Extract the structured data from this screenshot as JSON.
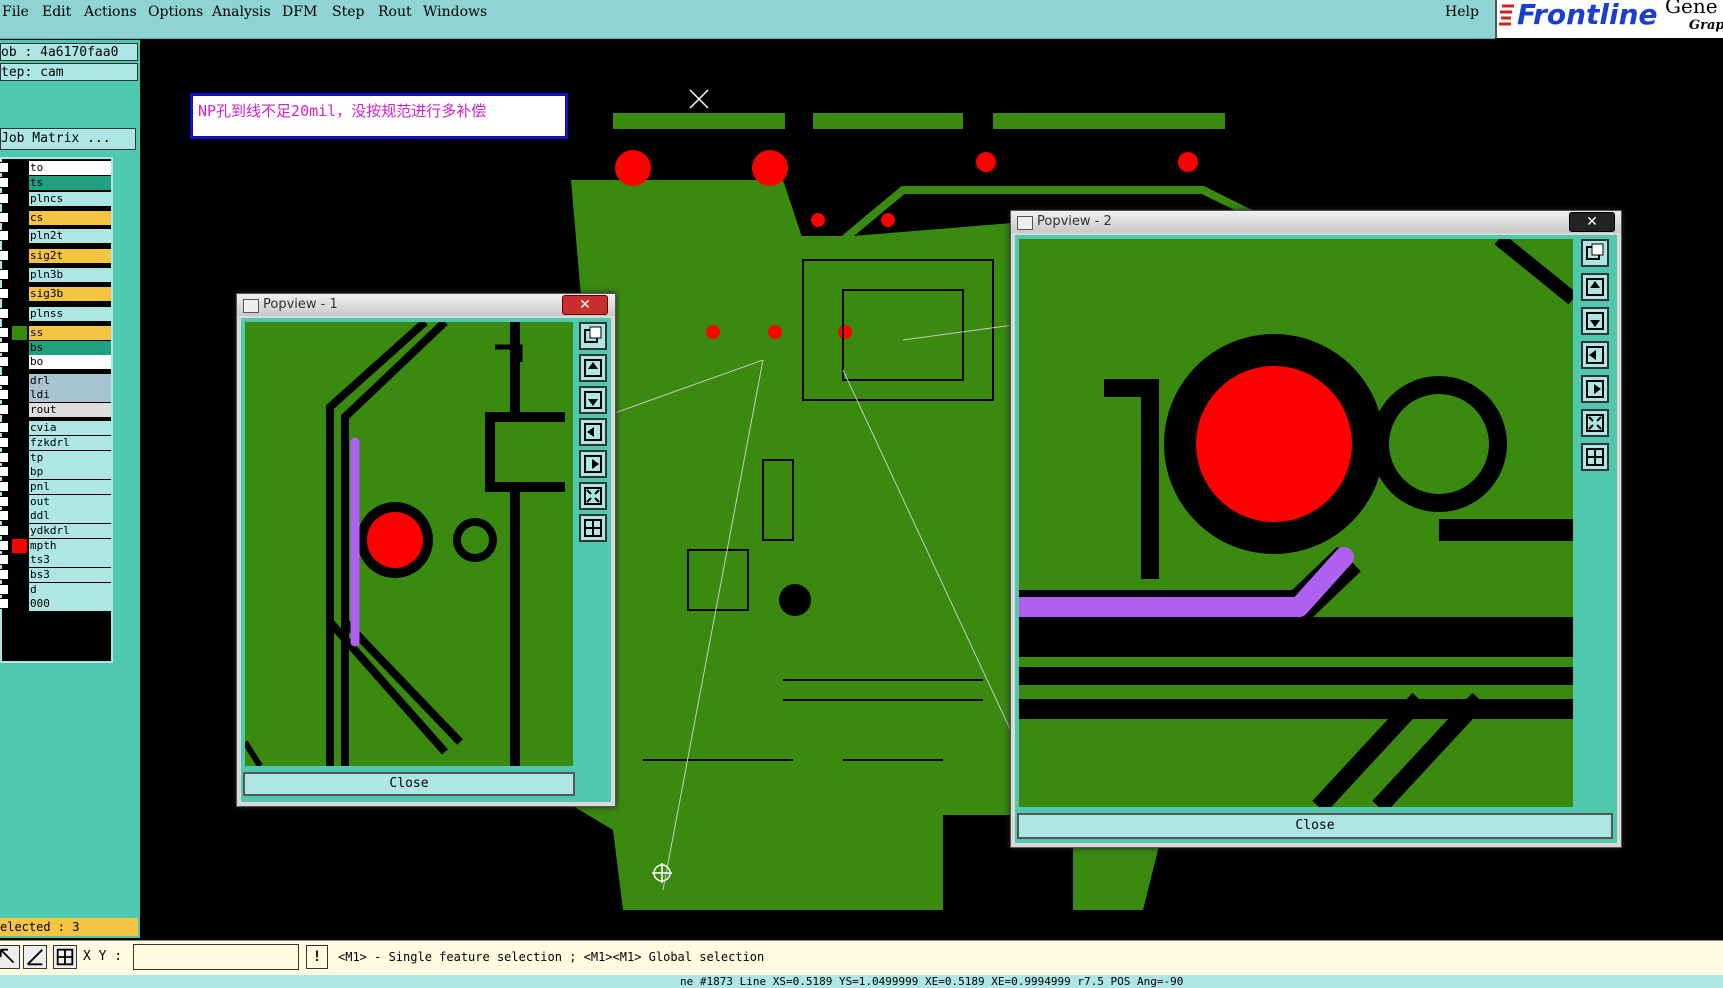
{
  "menu": {
    "items": [
      "File",
      "Edit",
      "Actions",
      "Options",
      "Analysis",
      "DFM",
      "Step",
      "Rout",
      "Windows"
    ],
    "help": "Help"
  },
  "logo": {
    "brand": "Frontline",
    "tail": "Gene",
    "sub": "Graph"
  },
  "left_panel": {
    "job": "ob  : 4a6170faa0",
    "step": "tep: cam",
    "job_matrix": "Job Matrix ...",
    "selected": "elected : 3"
  },
  "layers": [
    {
      "name": "to",
      "color": "#ffffff",
      "state": "white"
    },
    {
      "name": "ts",
      "color": "#20a080",
      "state": "green"
    },
    {
      "name": "plncs",
      "color": "#aee6e6",
      "state": "cyan"
    },
    {
      "name": "cs",
      "color": "#f5c542",
      "state": "yellow"
    },
    {
      "name": "pln2t",
      "color": "#aee6e6",
      "state": "cyan"
    },
    {
      "name": "sig2t",
      "color": "#f5c542",
      "state": "yellow"
    },
    {
      "name": "pln3b",
      "color": "#aee6e6",
      "state": "cyan"
    },
    {
      "name": "sig3b",
      "color": "#f5c542",
      "state": "yellow"
    },
    {
      "name": "plnss",
      "color": "#aee6e6",
      "state": "cyan"
    },
    {
      "name": "ss",
      "color": "#f5c542",
      "state": "yellow"
    },
    {
      "name": "bs",
      "color": "#20a080",
      "state": "green"
    },
    {
      "name": "bo",
      "color": "#ffffff",
      "state": "white"
    },
    {
      "name": "drl",
      "color": "#a8c4d0",
      "state": "grey"
    },
    {
      "name": "ldi",
      "color": "#a8c4d0",
      "state": "grey"
    },
    {
      "name": "rout",
      "color": "#dddddd",
      "state": "grey"
    },
    {
      "name": "cvia",
      "color": "#aee6e6",
      "state": "cyan"
    },
    {
      "name": "fzkdrl",
      "color": "#aee6e6",
      "state": "cyan"
    },
    {
      "name": "tp",
      "color": "#aee6e6",
      "state": "cyan"
    },
    {
      "name": "bp",
      "color": "#aee6e6",
      "state": "cyan"
    },
    {
      "name": "pnl",
      "color": "#aee6e6",
      "state": "cyan"
    },
    {
      "name": "out",
      "color": "#aee6e6",
      "state": "cyan"
    },
    {
      "name": "ddl",
      "color": "#aee6e6",
      "state": "cyan"
    },
    {
      "name": "ydkdrl",
      "color": "#aee6e6",
      "state": "cyan"
    },
    {
      "name": "mpth",
      "color": "#aee6e6",
      "state": "cyan"
    },
    {
      "name": "ts3",
      "color": "#aee6e6",
      "state": "cyan"
    },
    {
      "name": "bs3",
      "color": "#aee6e6",
      "state": "cyan"
    },
    {
      "name": "d",
      "color": "#aee6e6",
      "state": "cyan"
    },
    {
      "name": "000",
      "color": "#aee6e6",
      "state": "cyan"
    }
  ],
  "annotation": "NP孔到线不足20mil，没按规范进行多补偿",
  "popup1": {
    "title": "Popview - 1",
    "close": "Close"
  },
  "popup2": {
    "title": "Popview - 2",
    "close": "Close"
  },
  "bottom": {
    "xy_label": "X Y :",
    "xy_value": "",
    "hint": "<M1> - Single feature selection ; <M1><M1> Global selection",
    "status": "ne #1873 Line XS=0.5189 YS=1.0499999 XE=0.5189 XE=0.9994999 r7.5 POS Ang=-90"
  },
  "colors": {
    "board": "#3a8a10",
    "pad": "#ff0000",
    "trace": "#b060f0",
    "panel": "#4ec9b0"
  }
}
